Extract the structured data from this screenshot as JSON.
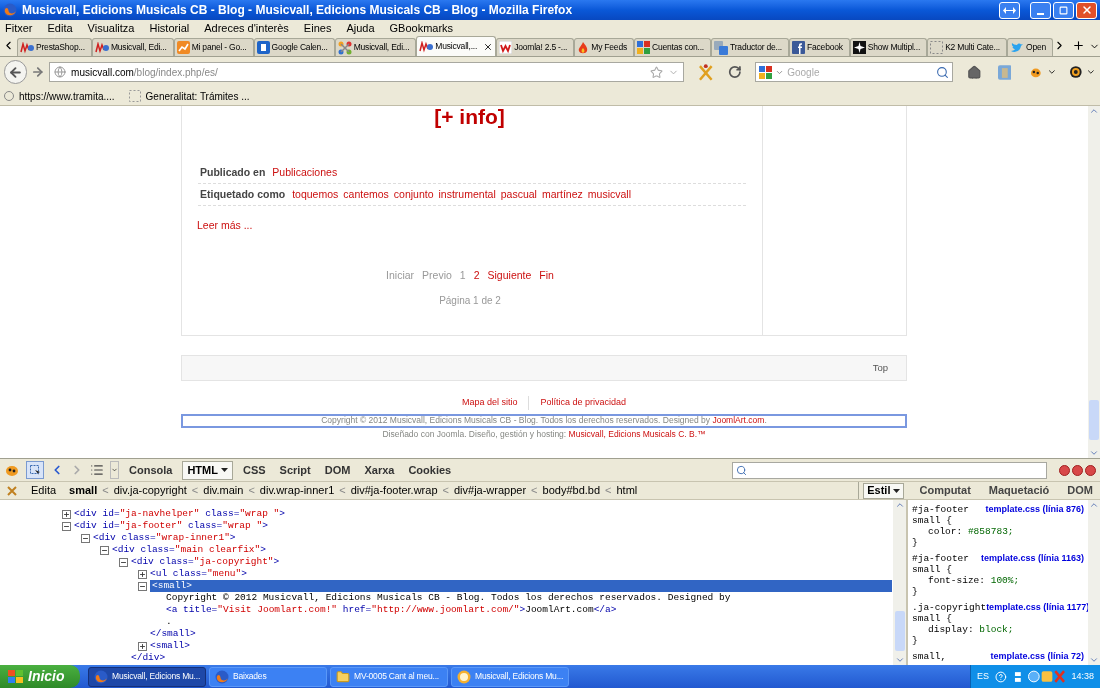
{
  "window": {
    "title": "Musicvall, Edicions Musicals CB - Blog - Musicvall, Edicions Musicals CB - Blog - Mozilla Firefox"
  },
  "menu": [
    "Fitxer",
    "Edita",
    "Visualitza",
    "Historial",
    "Adreces d'interès",
    "Eines",
    "Ajuda",
    "GBookmarks"
  ],
  "tabs": [
    {
      "label": "PrestaShop...",
      "kind": "wave",
      "selected": false
    },
    {
      "label": "Musicvall, Edi...",
      "kind": "wave",
      "selected": false
    },
    {
      "label": "Mi panel - Go...",
      "kind": "chart",
      "selected": false
    },
    {
      "label": "Google Calen...",
      "kind": "calendar",
      "selected": false
    },
    {
      "label": "Musicvall, Edi...",
      "kind": "pinwheel",
      "selected": false
    },
    {
      "label": "Musicvall,...",
      "kind": "wave",
      "selected": true
    },
    {
      "label": "Joomla! 2.5 -...",
      "kind": "logo",
      "selected": false
    },
    {
      "label": "My Feeds",
      "kind": "flame",
      "selected": false
    },
    {
      "label": "Cuentas con...",
      "kind": "squares",
      "selected": false
    },
    {
      "label": "Traductor de...",
      "kind": "translate",
      "selected": false
    },
    {
      "label": "Facebook",
      "kind": "social",
      "selected": false
    },
    {
      "label": "Show Multipl...",
      "kind": "burst",
      "selected": false
    },
    {
      "label": "K2 Multi Cate...",
      "kind": "dashed",
      "selected": false
    },
    {
      "label": "Open",
      "kind": "bird",
      "selected": false
    }
  ],
  "address_bar": {
    "host": "musicvall.com",
    "path": "/blog/index.php/es/"
  },
  "search": {
    "placeholder": "Google"
  },
  "bookmarks": [
    "https://www.tramita....",
    "Generalitat: Trámites ..."
  ],
  "page": {
    "info_link": "[+ info]",
    "meta": [
      {
        "label": "Publicado en",
        "links": [
          "Publicaciones"
        ]
      },
      {
        "label": "Etiquetado como",
        "links": [
          "toquemos",
          "cantemos",
          "conjunto",
          "instrumental",
          "pascual",
          "martínez",
          "musicvall"
        ]
      }
    ],
    "read_more": "Leer más ...",
    "pagination": [
      {
        "label": "Iniciar",
        "disabled": true
      },
      {
        "label": "Previo",
        "disabled": true
      },
      {
        "label": "1",
        "disabled": true
      },
      {
        "label": "2",
        "disabled": false
      },
      {
        "label": "Siguiente",
        "disabled": false
      },
      {
        "label": "Fin",
        "disabled": false
      }
    ],
    "page_info": "Página 1 de 2",
    "top_link": "Top",
    "footer_links": [
      "Mapa del sitio",
      "Política de privacidad"
    ],
    "copyright": {
      "text": "Copyright © 2012 Musicvall, Edicions Musicals CB - Blog. Todos los derechos reservados. Designed by",
      "link": "JoomlArt.com",
      "end": "."
    },
    "hosting": {
      "text": "Diseñado con Joomla. Diseño, gestión y hosting:",
      "link": "Musicvall, Edicions Musicals C. B.™"
    }
  },
  "devtools": {
    "panels": [
      {
        "label": "Consola",
        "selected": false
      },
      {
        "label": "HTML",
        "selected": true
      },
      {
        "label": "CSS",
        "selected": false
      },
      {
        "label": "Script",
        "selected": false
      },
      {
        "label": "DOM",
        "selected": false
      },
      {
        "label": "Xarxa",
        "selected": false
      },
      {
        "label": "Cookies",
        "selected": false
      }
    ],
    "edit_button": "Edita",
    "separator": "<",
    "breadcrumb": [
      {
        "label": "small",
        "selected": true
      },
      {
        "label": "div.ja-copyright",
        "selected": false
      },
      {
        "label": "div.main",
        "selected": false
      },
      {
        "label": "div.wrap-inner1",
        "selected": false
      },
      {
        "label": "div#ja-footer.wrap",
        "selected": false
      },
      {
        "label": "div#ja-wrapper",
        "selected": false
      },
      {
        "label": "body#bd.bd",
        "selected": false
      },
      {
        "label": "html",
        "selected": false
      }
    ],
    "side_tabs": [
      {
        "label": "Estil",
        "selected": true
      },
      {
        "label": "Computat",
        "selected": false
      },
      {
        "label": "Maquetació",
        "selected": false
      },
      {
        "label": "DOM",
        "selected": false
      }
    ],
    "tree": [
      {
        "expanded": false,
        "selected": false,
        "parts": [
          {
            "kind": "tag",
            "text": "<div"
          },
          {
            "kind": "attr",
            "text": " id="
          },
          {
            "kind": "value",
            "text": "\"ja-navhelper\""
          },
          {
            "kind": "attr",
            "text": " class="
          },
          {
            "kind": "value",
            "text": "\"wrap \""
          },
          {
            "kind": "tag",
            "text": ">"
          }
        ]
      },
      {
        "expanded": true,
        "selected": false,
        "parts": [
          {
            "kind": "tag",
            "text": "<div"
          },
          {
            "kind": "attr",
            "text": " id="
          },
          {
            "kind": "value",
            "text": "\"ja-footer\""
          },
          {
            "kind": "attr",
            "text": " class="
          },
          {
            "kind": "value",
            "text": "\"wrap \""
          },
          {
            "kind": "tag",
            "text": ">"
          }
        ],
        "children": [
          {
            "expanded": true,
            "selected": false,
            "parts": [
              {
                "kind": "tag",
                "text": "<div"
              },
              {
                "kind": "attr",
                "text": " class="
              },
              {
                "kind": "value",
                "text": "\"wrap-inner1\""
              },
              {
                "kind": "tag",
                "text": ">"
              }
            ],
            "children": [
              {
                "expanded": true,
                "selected": false,
                "parts": [
                  {
                    "kind": "tag",
                    "text": "<div"
                  },
                  {
                    "kind": "attr",
                    "text": " class="
                  },
                  {
                    "kind": "value",
                    "text": "\"main clearfix\""
                  },
                  {
                    "kind": "tag",
                    "text": ">"
                  }
                ],
                "children": [
                  {
                    "expanded": true,
                    "selected": false,
                    "parts": [
                      {
                        "kind": "tag",
                        "text": "<div"
                      },
                      {
                        "kind": "attr",
                        "text": " class="
                      },
                      {
                        "kind": "value",
                        "text": "\"ja-copyright\""
                      },
                      {
                        "kind": "tag",
                        "text": ">"
                      }
                    ],
                    "close": "</div>",
                    "children": [
                      {
                        "expanded": false,
                        "selected": false,
                        "parts": [
                          {
                            "kind": "tag",
                            "text": "<ul"
                          },
                          {
                            "kind": "attr",
                            "text": " class="
                          },
                          {
                            "kind": "value",
                            "text": "\"menu\""
                          },
                          {
                            "kind": "tag",
                            "text": ">"
                          }
                        ]
                      },
                      {
                        "expanded": true,
                        "selected": true,
                        "parts": [
                          {
                            "kind": "tag",
                            "text": "<small>"
                          }
                        ],
                        "close": "</small>",
                        "children": [
                          {
                            "parts": [
                              {
                                "kind": "text",
                                "text": "Copyright © 2012 Musicvall, Edicions Musicals CB - Blog. Todos los derechos reservados. Designed by"
                              }
                            ]
                          },
                          {
                            "parts": [
                              {
                                "kind": "tag",
                                "text": "<a"
                              },
                              {
                                "kind": "attr",
                                "text": " title="
                              },
                              {
                                "kind": "value",
                                "text": "\"Visit Joomlart.com!\""
                              },
                              {
                                "kind": "attr",
                                "text": " href="
                              },
                              {
                                "kind": "value",
                                "text": "\"http://www.joomlart.com/\""
                              },
                              {
                                "kind": "tag",
                                "text": ">"
                              },
                              {
                                "kind": "text",
                                "text": "JoomlArt.com"
                              },
                              {
                                "kind": "tag",
                                "text": "</a>"
                              }
                            ]
                          },
                          {
                            "parts": [
                              {
                                "kind": "text",
                                "text": "."
                              }
                            ]
                          }
                        ]
                      },
                      {
                        "expanded": false,
                        "selected": false,
                        "parts": [
                          {
                            "kind": "tag",
                            "text": "<small>"
                          }
                        ]
                      }
                    ]
                  }
                ]
              }
            ]
          }
        ]
      }
    ],
    "rules": [
      {
        "selector": [
          "#ja-footer",
          "small {"
        ],
        "source": "template.css (línia 876)",
        "declarations": [
          {
            "name": "color:",
            "value": "#858783;"
          }
        ],
        "close": "}"
      },
      {
        "selector": [
          "#ja-footer",
          "small {"
        ],
        "source": "template.css (línia 1163)",
        "declarations": [
          {
            "name": "font-size:",
            "value": "100%;"
          }
        ],
        "close": "}"
      },
      {
        "selector": [
          ".ja-copyright",
          "small {"
        ],
        "source": "template.css (línia 1177)",
        "declarations": [
          {
            "name": "display:",
            "value": "block;"
          }
        ],
        "close": "}"
      },
      {
        "selector": [
          "small,"
        ],
        "source": "template.css (línia 72)"
      }
    ]
  },
  "taskbar": {
    "start": "Inicio",
    "tasks": [
      {
        "label": "Musicvall, Edicions Mu...",
        "kind": "browser",
        "selected": true
      },
      {
        "label": "Baixades",
        "kind": "browser",
        "selected": false
      },
      {
        "label": "MV-0005 Cant al meu...",
        "kind": "folder",
        "selected": false
      },
      {
        "label": "Musicvall, Edicions Mu...",
        "kind": "globe",
        "selected": false
      }
    ],
    "language": "ES",
    "time": "14:38"
  }
}
